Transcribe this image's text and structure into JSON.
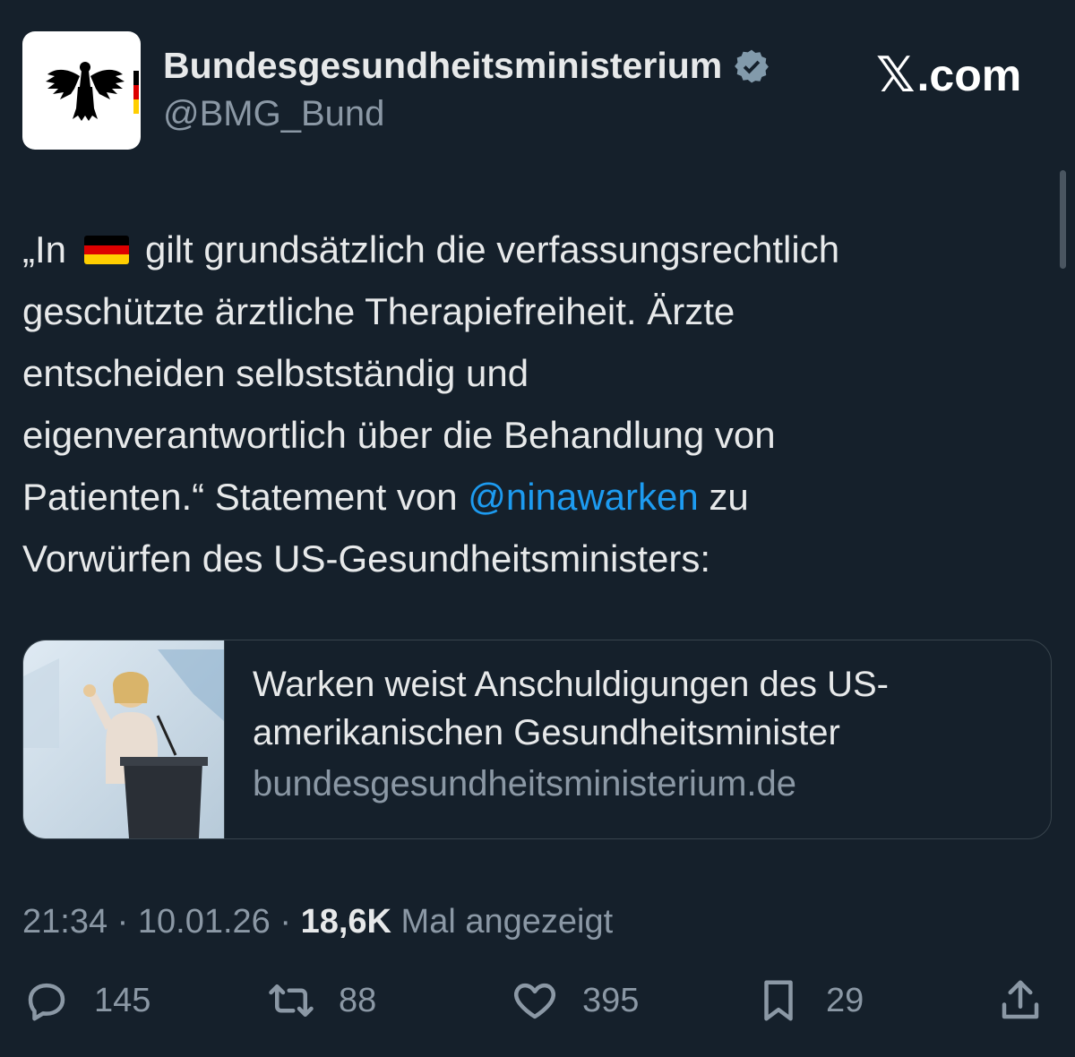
{
  "author": {
    "name": "Bundesgesundheitsministerium",
    "handle": "@BMG_Bund",
    "verified": true,
    "avatar_icon": "federal-eagle-with-german-flag"
  },
  "site": {
    "label": ".com",
    "logo_glyph": "𝕏"
  },
  "tweet": {
    "lines": [
      "gilt grundsätzlich die verfassungsrechtlich",
      "geschützte ärztliche Therapiefreiheit. Ärzte",
      "entscheiden selbstständig und",
      "eigenverantwortlich über die Behandlung von",
      "zu",
      "Vorwürfen des US-Gesundheitsministers:"
    ],
    "prefix": "„In",
    "flag_emoji": "germany-flag",
    "line5_before_mention": "Patienten.“ Statement von ",
    "mention": "@ninawarken"
  },
  "link_card": {
    "title_line1": "Warken weist Anschuldigungen des US-",
    "title_line2": "amerikanischen Gesundheitsminister",
    "domain": "bundesgesundheitsministerium.de",
    "image_description_icon": "speaker-at-podium-photo"
  },
  "meta": {
    "time": "21:34",
    "separator": "·",
    "date": "10.01.26",
    "views_count": "18,6K",
    "views_label": "Mal angezeigt"
  },
  "actions": {
    "replies": "145",
    "reposts": "88",
    "likes": "395",
    "bookmarks": "29"
  },
  "colors": {
    "background": "#15202b",
    "text": "#e7e9ea",
    "secondary": "#8b98a5",
    "link": "#1d9bf0",
    "border": "#38444d"
  }
}
